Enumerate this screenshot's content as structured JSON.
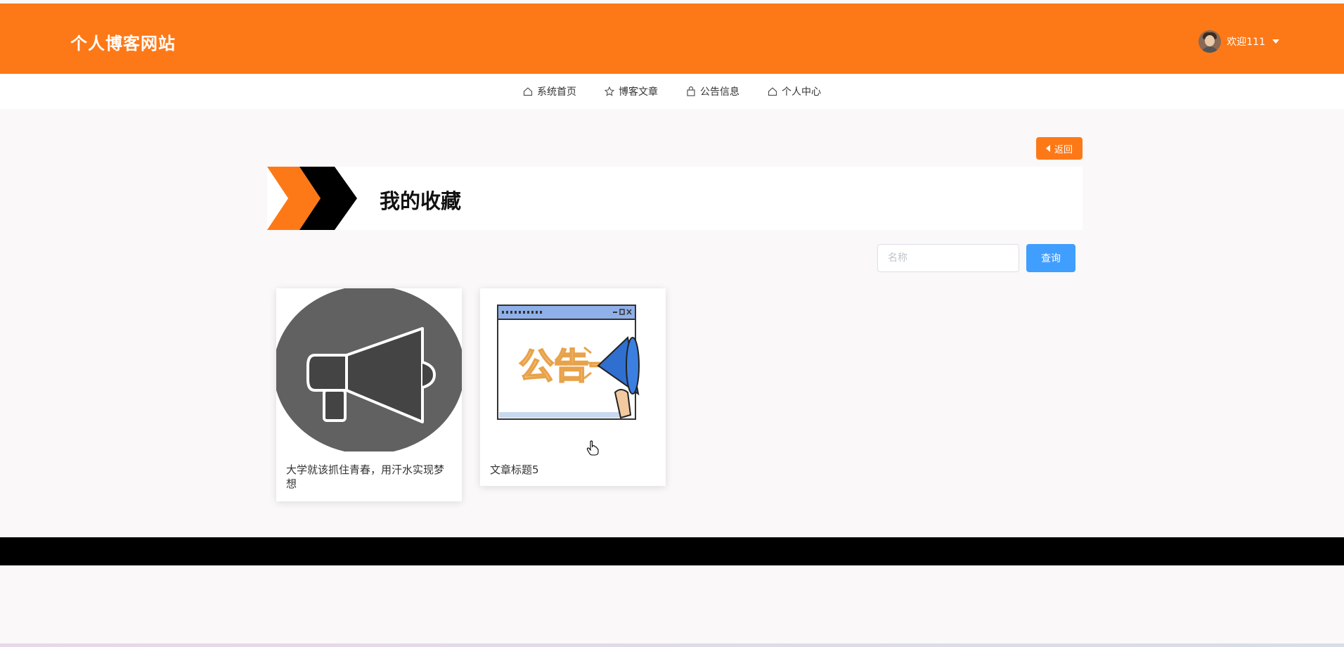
{
  "header": {
    "site_title": "个人博客网站",
    "user_greeting": "欢迎111",
    "accent_color": "#fd7917"
  },
  "nav": {
    "items": [
      {
        "label": "系统首页",
        "icon": "home-icon"
      },
      {
        "label": "博客文章",
        "icon": "star-icon"
      },
      {
        "label": "公告信息",
        "icon": "bag-icon"
      },
      {
        "label": "个人中心",
        "icon": "home-icon"
      }
    ]
  },
  "toolbar": {
    "back_label": "返回"
  },
  "page": {
    "title": "我的收藏"
  },
  "search": {
    "placeholder": "名称",
    "value": "",
    "button_label": "查询",
    "button_color": "#409eff"
  },
  "favorites": [
    {
      "title": "大学就该抓住青春，用汗水实现梦想",
      "image": "megaphone-icon"
    },
    {
      "title": "文章标题5",
      "image": "announcement-banner-image",
      "image_text": "公告一"
    }
  ]
}
